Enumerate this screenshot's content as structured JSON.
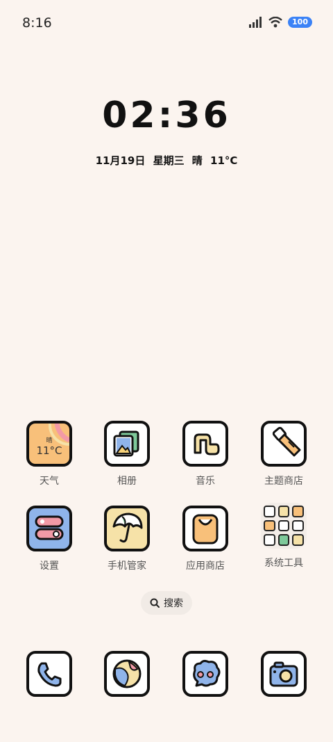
{
  "status": {
    "time": "8:16",
    "battery": "100"
  },
  "lock": {
    "clock": "02:36",
    "date": "11月19日 星期三 晴 11°C"
  },
  "apps_row1": [
    {
      "label": "天气",
      "weather_cond": "晴",
      "weather_temp": "11°C"
    },
    {
      "label": "相册"
    },
    {
      "label": "音乐"
    },
    {
      "label": "主题商店"
    }
  ],
  "apps_row2": [
    {
      "label": "设置"
    },
    {
      "label": "手机管家"
    },
    {
      "label": "应用商店"
    },
    {
      "label": "系统工具"
    }
  ],
  "search": {
    "label": "搜索"
  },
  "dock": [
    {
      "name": "phone-icon"
    },
    {
      "name": "browser-icon"
    },
    {
      "name": "messages-icon"
    },
    {
      "name": "camera-icon"
    }
  ]
}
